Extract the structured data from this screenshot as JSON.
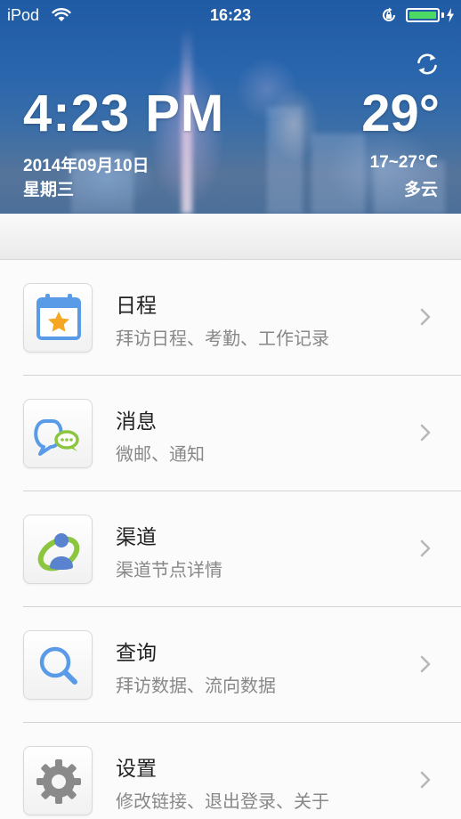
{
  "status_bar": {
    "carrier": "iPod",
    "time": "16:23",
    "battery_level": 1.0,
    "battery_color": "#4cd964",
    "icons": [
      "wifi-icon",
      "orientation-lock-icon",
      "battery-icon",
      "charging-icon"
    ]
  },
  "weather_header": {
    "clock": "4:23 PM",
    "date": "2014年09月10日",
    "weekday": "星期三",
    "temperature": "29°",
    "temp_range": "17~27℃",
    "condition": "多云",
    "refresh_icon": "refresh-icon"
  },
  "menu": {
    "items": [
      {
        "title": "日程",
        "subtitle": "拜访日程、考勤、工作记录",
        "icon": "calendar-icon"
      },
      {
        "title": "消息",
        "subtitle": "微邮、通知",
        "icon": "message-icon"
      },
      {
        "title": "渠道",
        "subtitle": "渠道节点详情",
        "icon": "channel-icon"
      },
      {
        "title": "查询",
        "subtitle": "拜访数据、流向数据",
        "icon": "search-icon"
      },
      {
        "title": "设置",
        "subtitle": "修改链接、退出登录、关于",
        "icon": "gear-icon"
      }
    ]
  },
  "colors": {
    "accent_blue": "#5a9be8",
    "green": "#8cc63f",
    "star_orange": "#f5a623",
    "gear_grey": "#8a8a8a"
  }
}
